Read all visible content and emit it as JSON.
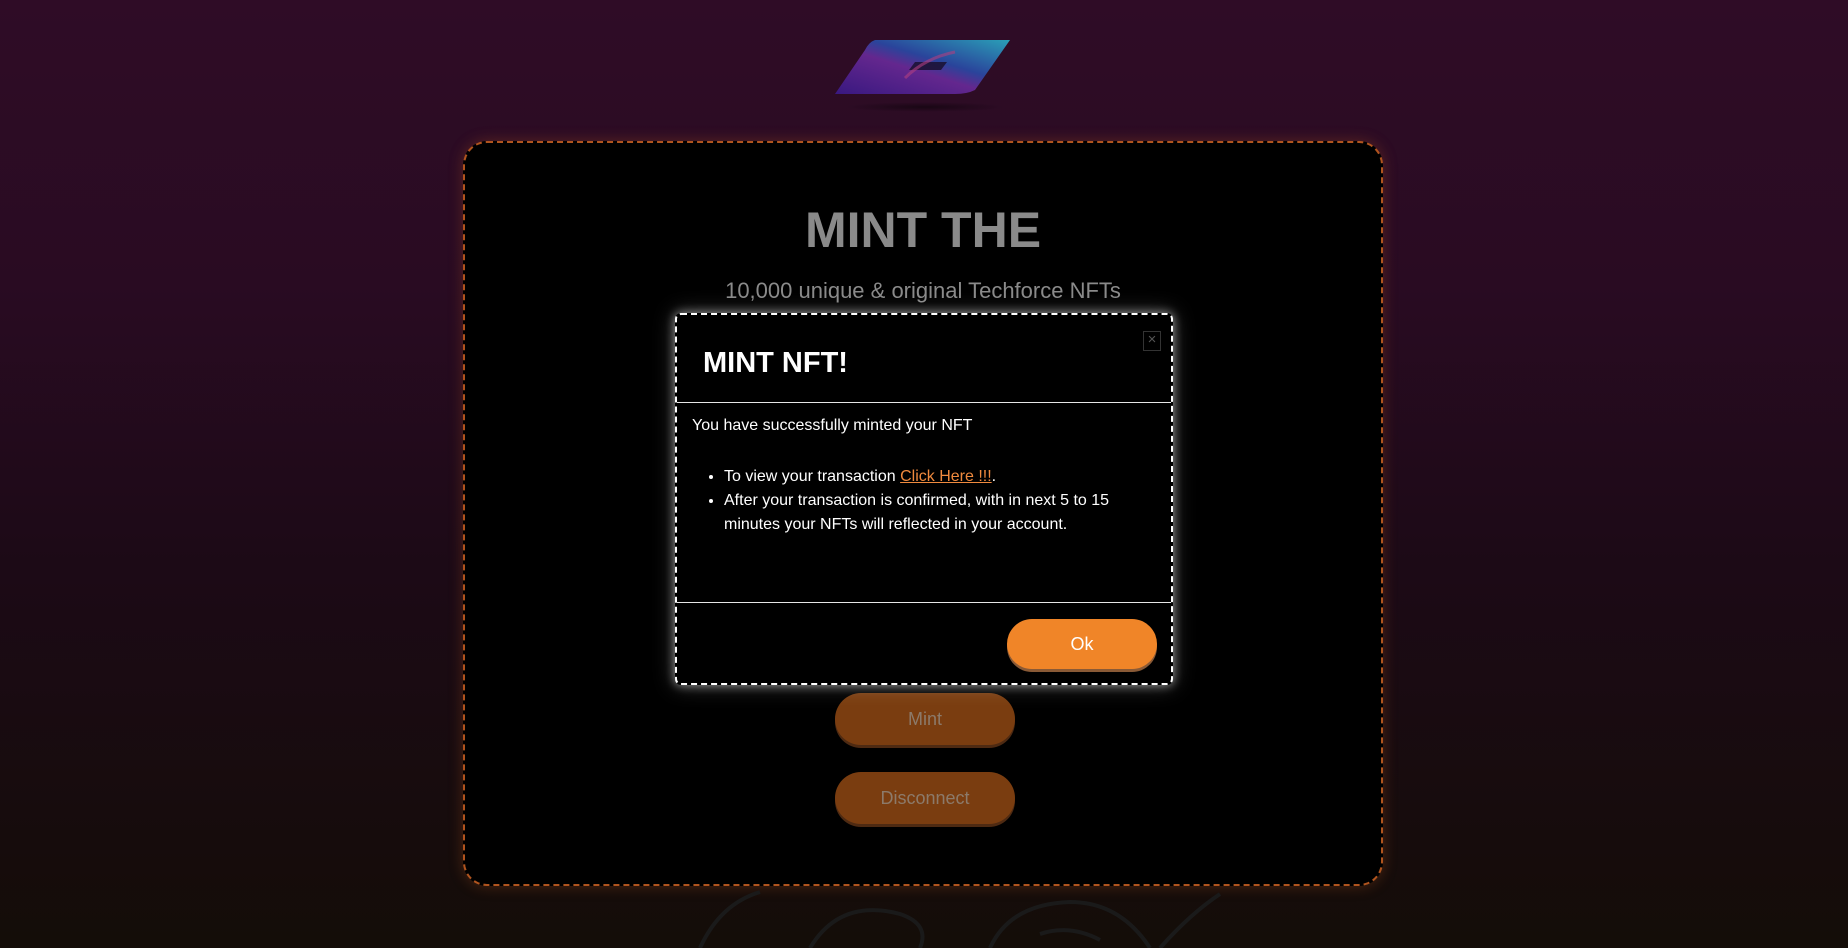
{
  "logo": {
    "icon": "brand-logo-icon"
  },
  "main": {
    "title": "MINT THE",
    "subtitle": "10,000 unique & original Techforce NFTs",
    "mint_label": "Mint",
    "disconnect_label": "Disconnect"
  },
  "modal": {
    "close_label": "×",
    "title": "MINT NFT!",
    "message": "You have successfully minted your NFT",
    "item1_prefix": "To view your transaction ",
    "item1_link": "Click Here !!!",
    "item1_suffix": ".",
    "item2": "After your transaction is confirmed, with in next 5 to 15 minutes your NFTs will reflected in your account.",
    "ok_label": "Ok"
  },
  "colors": {
    "accent": "#f08528",
    "link": "#f08a3e",
    "card_border": "#b0541e"
  }
}
